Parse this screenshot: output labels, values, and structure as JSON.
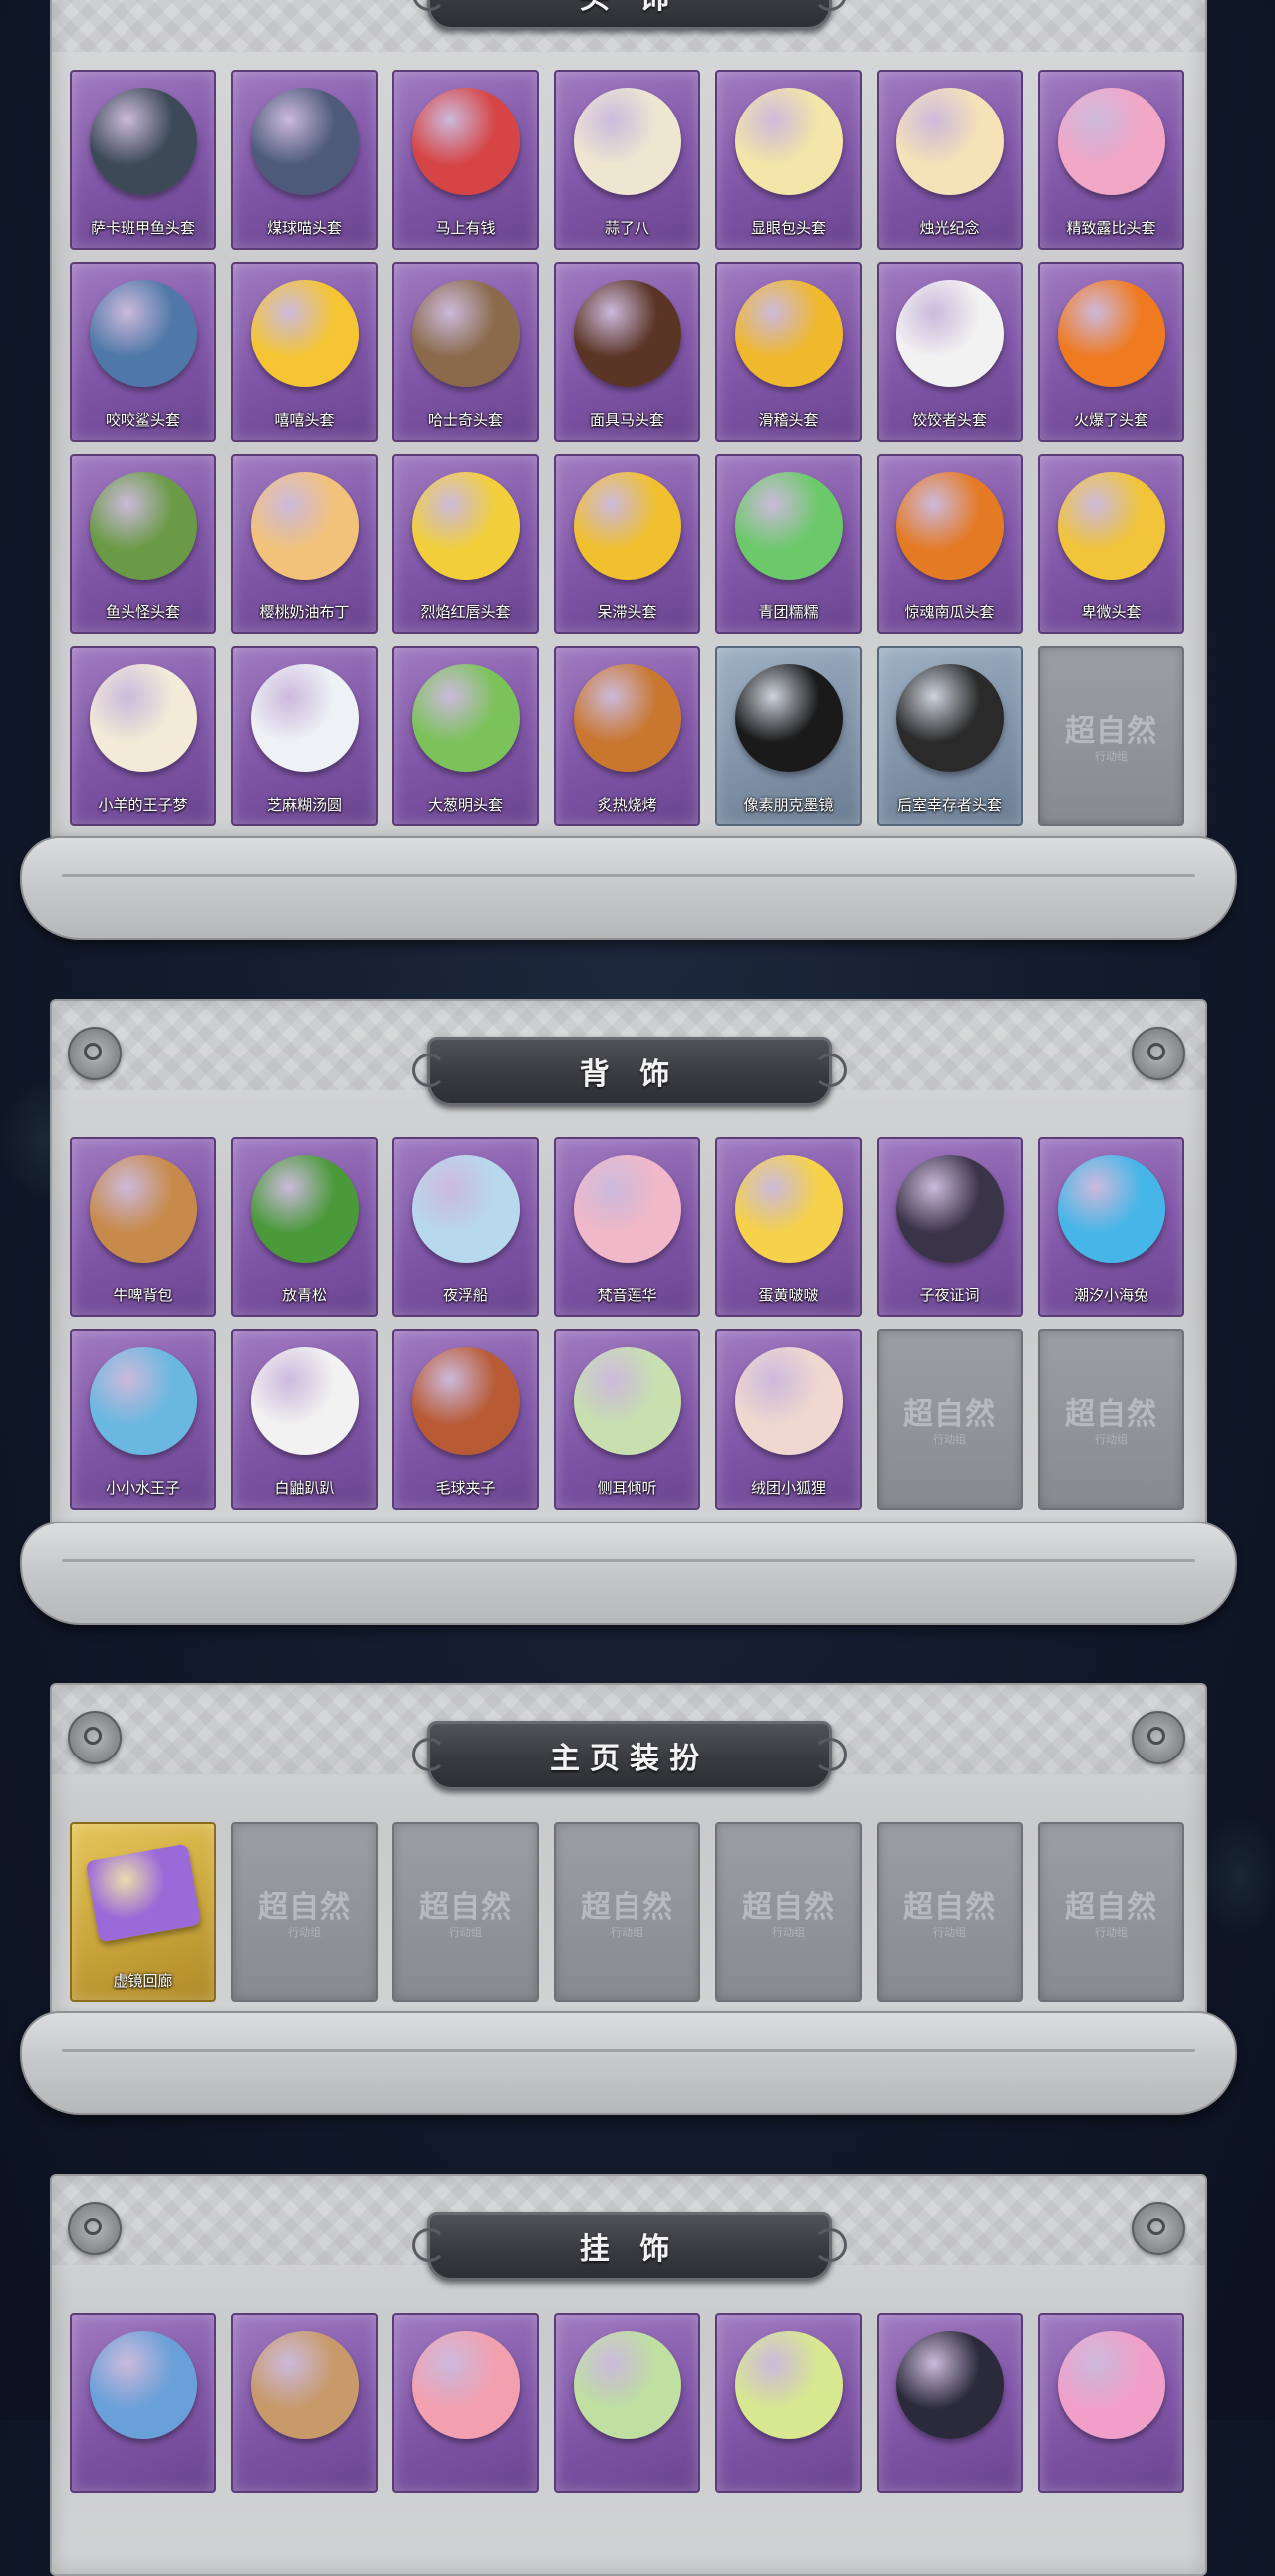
{
  "sections": [
    {
      "title": "头 饰",
      "items": [
        {
          "label": "萨卡班甲鱼头套",
          "icon": "fish-head-icon",
          "color": "#3c4a57"
        },
        {
          "label": "煤球喵头套",
          "icon": "cat-head-icon",
          "color": "#4d5a7a"
        },
        {
          "label": "马上有钱",
          "icon": "red-horse-head-icon",
          "color": "#d64545"
        },
        {
          "label": "蒜了八",
          "icon": "garlic-head-icon",
          "color": "#efe6d2"
        },
        {
          "label": "显眼包头套",
          "icon": "bulb-face-icon",
          "color": "#f4e6a8"
        },
        {
          "label": "烛光纪念",
          "icon": "candle-head-icon",
          "color": "#f6e2b8"
        },
        {
          "label": "精致露比头套",
          "icon": "pink-pig-head-icon",
          "color": "#f2a7c7"
        },
        {
          "label": "咬咬鲨头套",
          "icon": "shark-head-icon",
          "color": "#4f78a8"
        },
        {
          "label": "嘻嘻头套",
          "icon": "grin-emoji-icon",
          "color": "#f5c533"
        },
        {
          "label": "哈士奇头套",
          "icon": "husky-head-icon",
          "color": "#8a6a4a"
        },
        {
          "label": "面具马头套",
          "icon": "horse-mask-icon",
          "color": "#5a3424"
        },
        {
          "label": "滑稽头套",
          "icon": "smirk-emoji-icon",
          "color": "#f0b82d"
        },
        {
          "label": "饺饺者头套",
          "icon": "dumpling-head-icon",
          "color": "#f2f2f2"
        },
        {
          "label": "火爆了头套",
          "icon": "fire-head-icon",
          "color": "#f07a20"
        },
        {
          "label": "鱼头怪头套",
          "icon": "green-fish-head-icon",
          "color": "#6a9a45"
        },
        {
          "label": "樱桃奶油布丁",
          "icon": "pudding-head-icon",
          "color": "#f3c27a"
        },
        {
          "label": "烈焰红唇头套",
          "icon": "yellow-mouse-head-icon",
          "color": "#f2cf3a"
        },
        {
          "label": "呆滞头套",
          "icon": "stunned-emoji-icon",
          "color": "#f1c02e"
        },
        {
          "label": "青团糯糯",
          "icon": "green-rice-ball-icon",
          "color": "#6cc96a"
        },
        {
          "label": "惊魂南瓜头套",
          "icon": "pumpkin-head-icon",
          "color": "#e57a25"
        },
        {
          "label": "卑微头套",
          "icon": "humble-emoji-icon",
          "color": "#f1c43a"
        },
        {
          "label": "小羊的王子梦",
          "icon": "sheep-crown-icon",
          "color": "#f4ead8"
        },
        {
          "label": "芝麻糊汤圆",
          "icon": "tangyuan-head-icon",
          "color": "#eef2f6"
        },
        {
          "label": "大葱明头套",
          "icon": "scallion-head-icon",
          "color": "#7cc25a"
        },
        {
          "label": "炙热烧烤",
          "icon": "bbq-skewer-icon",
          "color": "#c9772f"
        },
        {
          "label": "像素朋克墨镜",
          "icon": "pixel-sunglasses-icon",
          "color": "#1a1a1a",
          "variant": "blue"
        },
        {
          "label": "后室幸存者头套",
          "icon": "gas-mask-helmet-icon",
          "color": "#2a2a2a",
          "variant": "blue"
        },
        {
          "label": "",
          "icon": "locked-placeholder-icon",
          "variant": "locked"
        }
      ]
    },
    {
      "title": "背 饰",
      "items": [
        {
          "label": "牛啤背包",
          "icon": "cow-barrel-icon",
          "color": "#c78a4a"
        },
        {
          "label": "放青松",
          "icon": "bonsai-pine-icon",
          "color": "#4a9a3a"
        },
        {
          "label": "夜浮船",
          "icon": "crystal-ship-icon",
          "color": "#b8d8ee"
        },
        {
          "label": "梵音莲华",
          "icon": "lotus-girl-icon",
          "color": "#f0b8c8"
        },
        {
          "label": "蛋黄啵啵",
          "icon": "chick-egg-icon",
          "color": "#f6d24a"
        },
        {
          "label": "子夜证词",
          "icon": "raven-mask-icon",
          "color": "#3a3448"
        },
        {
          "label": "潮汐小海兔",
          "icon": "sea-bunny-icon",
          "color": "#46b6e8"
        },
        {
          "label": "小小水王子",
          "icon": "water-prince-icon",
          "color": "#6ab8e0"
        },
        {
          "label": "白鼬趴趴",
          "icon": "white-ferret-icon",
          "color": "#f2f2f2"
        },
        {
          "label": "毛球夹子",
          "icon": "raccoon-clip-icon",
          "color": "#b85a34"
        },
        {
          "label": "侧耳倾听",
          "icon": "floral-wreath-icon",
          "color": "#c8e0b0"
        },
        {
          "label": "绒团小狐狸",
          "icon": "fluffy-fox-icon",
          "color": "#f0d8d0"
        },
        {
          "label": "",
          "icon": "locked-placeholder-icon",
          "variant": "locked"
        },
        {
          "label": "",
          "icon": "locked-placeholder-icon",
          "variant": "locked"
        }
      ]
    },
    {
      "title": "主页装扮",
      "items": [
        {
          "label": "虚镜回廊",
          "icon": "mirror-card-icon",
          "color": "#9a6ad8",
          "variant": "gold"
        },
        {
          "label": "",
          "icon": "locked-placeholder-icon",
          "variant": "locked"
        },
        {
          "label": "",
          "icon": "locked-placeholder-icon",
          "variant": "locked"
        },
        {
          "label": "",
          "icon": "locked-placeholder-icon",
          "variant": "locked"
        },
        {
          "label": "",
          "icon": "locked-placeholder-icon",
          "variant": "locked"
        },
        {
          "label": "",
          "icon": "locked-placeholder-icon",
          "variant": "locked"
        },
        {
          "label": "",
          "icon": "locked-placeholder-icon",
          "variant": "locked"
        }
      ]
    },
    {
      "title": "挂 饰",
      "items": [
        {
          "label": "",
          "icon": "shark-charm-icon",
          "color": "#6aa0d8"
        },
        {
          "label": "",
          "icon": "bear-charm-icon",
          "color": "#c89a6a"
        },
        {
          "label": "",
          "icon": "pink-cat-charm-icon",
          "color": "#f2a0b0"
        },
        {
          "label": "",
          "icon": "melon-charm-icon",
          "color": "#bfe0a0"
        },
        {
          "label": "",
          "icon": "leaf-sprite-charm-icon",
          "color": "#d8e890"
        },
        {
          "label": "",
          "icon": "girl-charm-icon",
          "color": "#2a2a3a"
        },
        {
          "label": "",
          "icon": "pink-doll-charm-icon",
          "color": "#f0a0c8"
        }
      ]
    }
  ],
  "locked_watermark": {
    "main": "超自然",
    "sub": "行动组"
  },
  "colors": {
    "card_purple": "#7f55a6",
    "card_gold": "#c9a53b",
    "card_locked": "#888a8f",
    "panel": "#d2d3d4"
  }
}
